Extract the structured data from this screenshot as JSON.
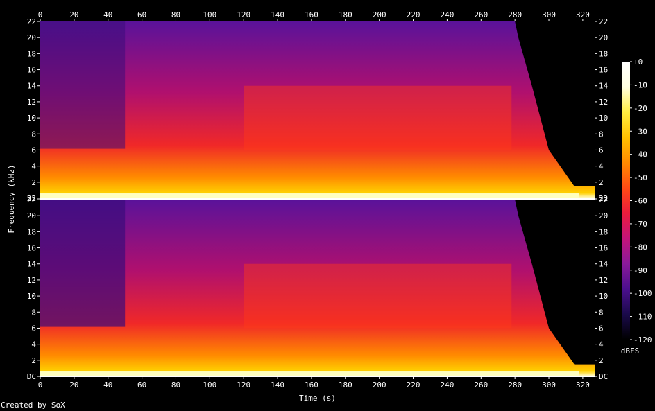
{
  "chart_data": {
    "type": "heatmap",
    "title": "",
    "xlabel": "Time (s)",
    "ylabel": "Frequency (kHz)",
    "xlim": [
      0,
      327
    ],
    "ylim": [
      0,
      22
    ],
    "x_ticks": [
      0,
      20,
      40,
      60,
      80,
      100,
      120,
      140,
      160,
      180,
      200,
      220,
      240,
      260,
      280,
      300,
      320
    ],
    "channels": [
      {
        "y_ticks": [
          {
            "v": 0,
            "label": "22"
          },
          {
            "v": 2,
            "label": "2"
          },
          {
            "v": 4,
            "label": "4"
          },
          {
            "v": 6,
            "label": "6"
          },
          {
            "v": 8,
            "label": "8"
          },
          {
            "v": 10,
            "label": "10"
          },
          {
            "v": 12,
            "label": "12"
          },
          {
            "v": 14,
            "label": "14"
          },
          {
            "v": 16,
            "label": "16"
          },
          {
            "v": 18,
            "label": "18"
          },
          {
            "v": 20,
            "label": "20"
          },
          {
            "v": 22,
            "label": "22"
          }
        ]
      },
      {
        "y_ticks": [
          {
            "v": 0,
            "label": "DC"
          },
          {
            "v": 2,
            "label": "2"
          },
          {
            "v": 4,
            "label": "4"
          },
          {
            "v": 6,
            "label": "6"
          },
          {
            "v": 8,
            "label": "8"
          },
          {
            "v": 10,
            "label": "10"
          },
          {
            "v": 12,
            "label": "12"
          },
          {
            "v": 14,
            "label": "14"
          },
          {
            "v": 16,
            "label": "16"
          },
          {
            "v": 18,
            "label": "18"
          },
          {
            "v": 20,
            "label": "20"
          },
          {
            "v": 22,
            "label": "22"
          }
        ]
      }
    ],
    "colorbar": {
      "label": "dBFS",
      "range": [
        -120,
        0
      ],
      "ticks": [
        {
          "v": 0,
          "label": "+0"
        },
        {
          "v": -10,
          "label": "-10"
        },
        {
          "v": -20,
          "label": "-20"
        },
        {
          "v": -30,
          "label": "-30"
        },
        {
          "v": -40,
          "label": "-40"
        },
        {
          "v": -50,
          "label": "-50"
        },
        {
          "v": -60,
          "label": "-60"
        },
        {
          "v": -70,
          "label": "-70"
        },
        {
          "v": -80,
          "label": "-80"
        },
        {
          "v": -90,
          "label": "-90"
        },
        {
          "v": -100,
          "label": "-100"
        },
        {
          "v": -110,
          "label": "-110"
        },
        {
          "v": -120,
          "label": "-120"
        }
      ],
      "colormap": [
        "#000000",
        "#1a0a4a",
        "#4b0f8e",
        "#8a1a9a",
        "#c4147a",
        "#ec1c3c",
        "#ff4a14",
        "#ff8a00",
        "#ffc000",
        "#ffee40",
        "#ffffe0",
        "#ffffff"
      ]
    }
  },
  "footer": {
    "credit": "Created by SoX"
  }
}
